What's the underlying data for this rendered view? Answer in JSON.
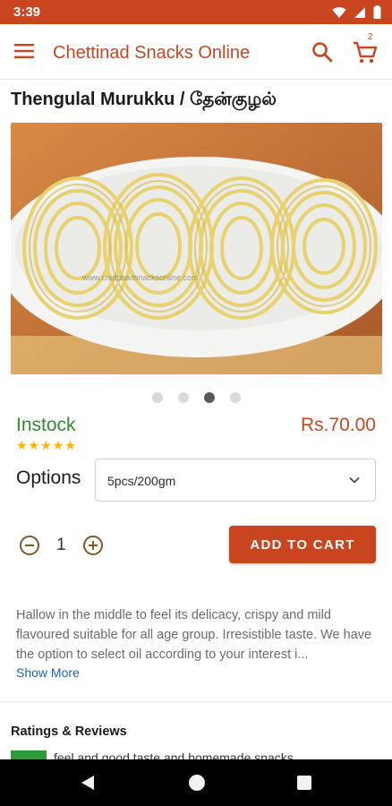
{
  "status_bar": {
    "time": "3:39",
    "icons": [
      "wifi-icon",
      "signal-icon",
      "battery-icon"
    ]
  },
  "app_bar": {
    "title": "Chettinad Snacks Online",
    "menu_icon": "hamburger-icon",
    "search_icon": "search-icon",
    "cart_icon": "cart-icon",
    "cart_count": "2"
  },
  "product": {
    "title": "Thengulal Murukku / தேன்குழல்",
    "image_watermark": "www.chettinadsnacksonline.com",
    "carousel": {
      "total": 4,
      "active_index": 2
    },
    "stock_status": "Instock",
    "rating_stars": "★★★★★",
    "rating": 5,
    "price": "Rs.70.00",
    "options_label": "Options",
    "selected_option": "5pcs/200gm",
    "quantity": "1",
    "add_to_cart_label": "ADD TO CART",
    "description": "Hallow in the middle to feel its delicacy, crispy and mild flavoured suitable for all age group. Irresistible taste. We have the option to select oil according to your interest i...",
    "show_more_label": "Show More"
  },
  "reviews": {
    "heading": "Ratings & Reviews",
    "first_review_peek": "feel and good taste and homemade snacks"
  },
  "colors": {
    "brand": "#c8451f",
    "instock": "#2e8b2e",
    "star": "#ffb400",
    "link": "#1565c0"
  },
  "nav_bar": {
    "back_icon": "back-icon",
    "home_icon": "home-icon",
    "recents_icon": "recents-icon"
  }
}
